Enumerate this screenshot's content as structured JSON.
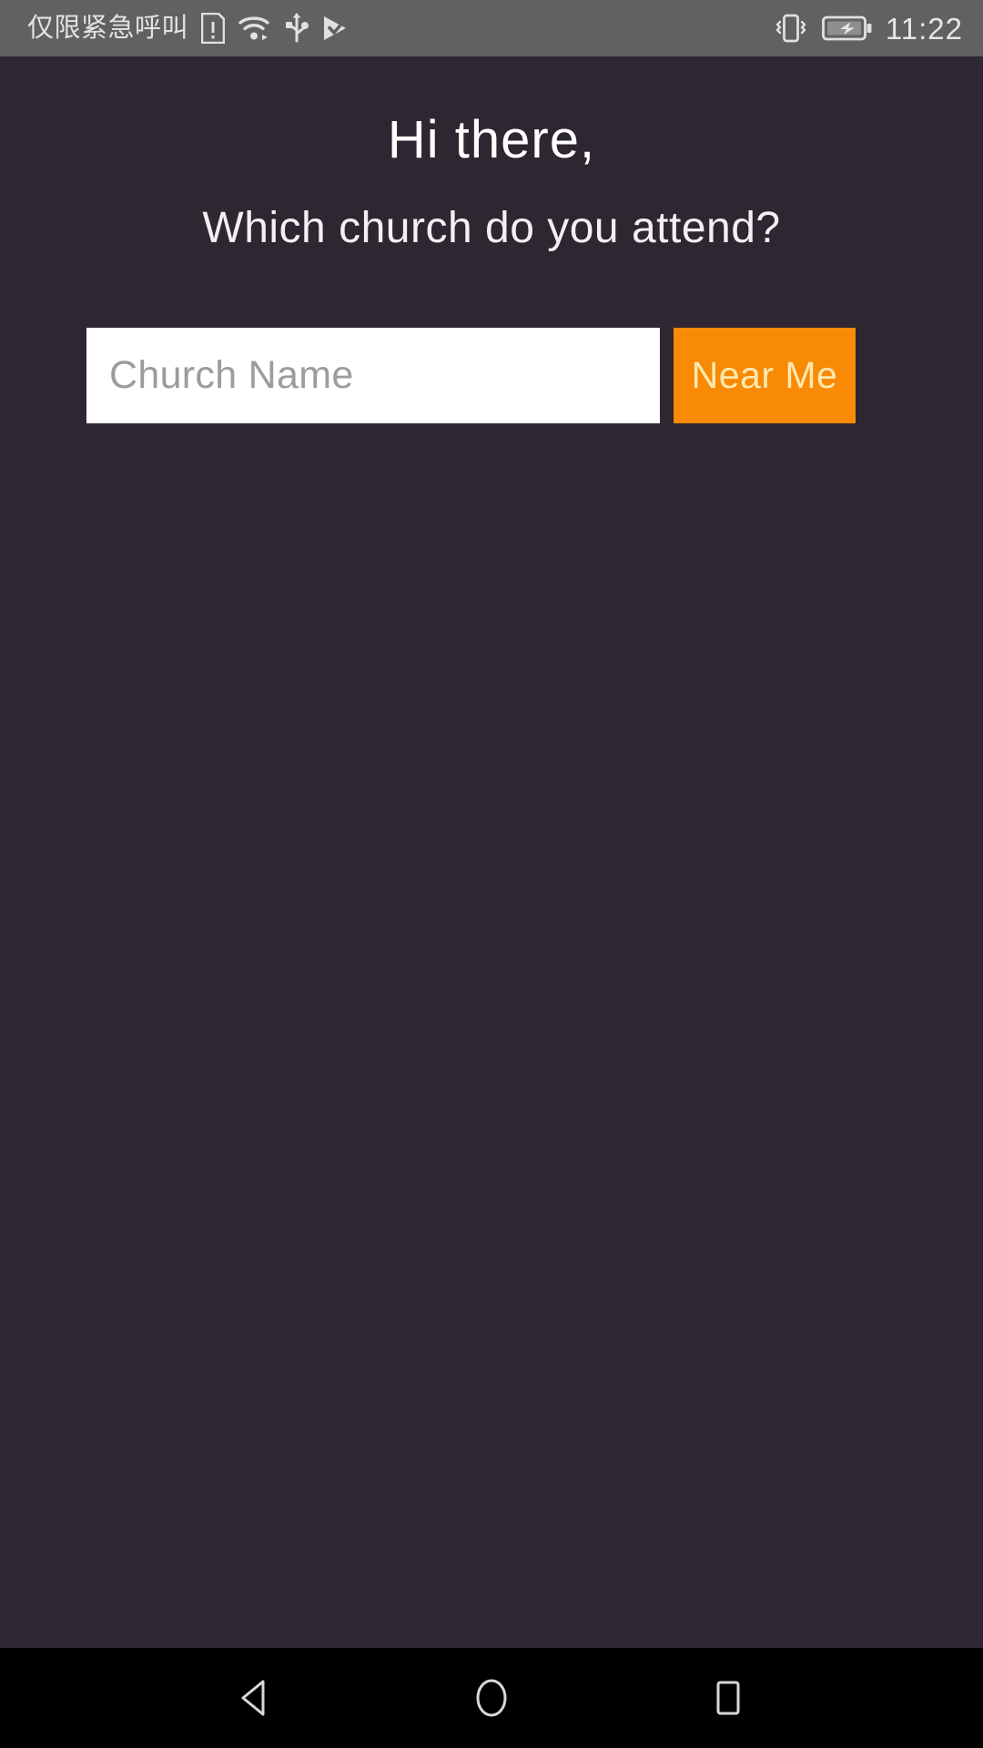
{
  "status_bar": {
    "carrier_text": "仅限紧急呼叫",
    "clock": "11:22",
    "left_icons": [
      {
        "name": "sim-card-alert-icon"
      },
      {
        "name": "wifi-icon"
      },
      {
        "name": "usb-icon"
      },
      {
        "name": "play-store-checkmark-icon"
      }
    ],
    "right_icons": [
      {
        "name": "vibrate-icon"
      },
      {
        "name": "battery-charging-icon"
      }
    ],
    "background_color": "#616161",
    "text_color": "#e3e3e3"
  },
  "main": {
    "greeting": "Hi there,",
    "question": "Which church do you attend?",
    "search": {
      "input_value": "",
      "placeholder": "Church Name",
      "button_label": "Near Me"
    },
    "background_color": "#2e2630",
    "accent_color": "#f98a05",
    "button_text_color": "#ffe9b0"
  },
  "nav_bar": {
    "background_color": "#000000",
    "buttons": [
      {
        "name": "back-button",
        "icon": "triangle-left-icon"
      },
      {
        "name": "home-button",
        "icon": "circle-icon"
      },
      {
        "name": "recents-button",
        "icon": "square-icon"
      }
    ]
  }
}
